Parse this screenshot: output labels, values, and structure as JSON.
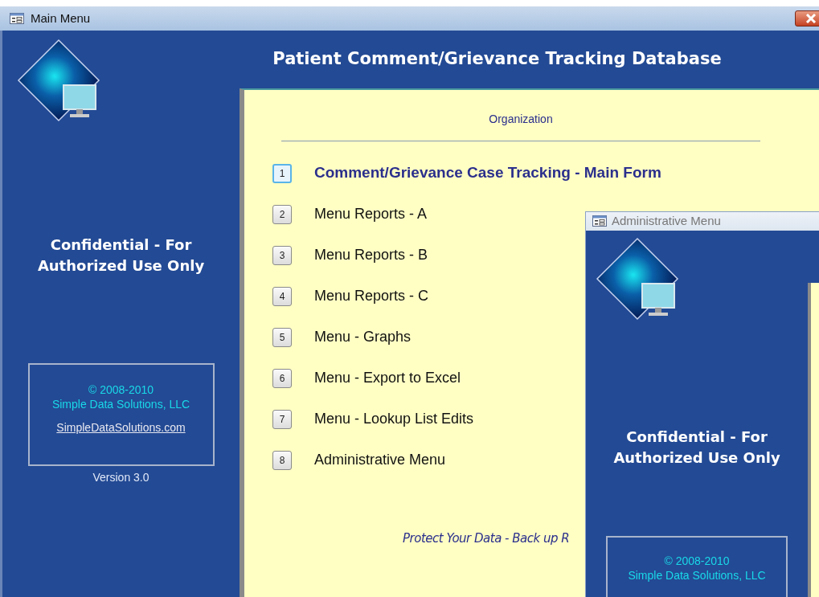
{
  "window": {
    "title": "Main Menu",
    "header": "Patient Comment/Grievance Tracking Database"
  },
  "sidebar": {
    "notice": "Confidential - For Authorized Use Only",
    "copyright": "© 2008-2010",
    "company": "Simple Data Solutions, LLC",
    "link": "SimpleDataSolutions.com",
    "version": "Version 3.0"
  },
  "panel": {
    "organization": "Organization",
    "menu": [
      {
        "key": "1",
        "label": "Comment/Grievance Case Tracking - Main Form",
        "selected": true
      },
      {
        "key": "2",
        "label": "Menu Reports - A",
        "selected": false
      },
      {
        "key": "3",
        "label": "Menu Reports - B",
        "selected": false
      },
      {
        "key": "4",
        "label": "Menu Reports - C",
        "selected": false
      },
      {
        "key": "5",
        "label": "Menu - Graphs",
        "selected": false
      },
      {
        "key": "6",
        "label": "Menu - Export to Excel",
        "selected": false
      },
      {
        "key": "7",
        "label": "Menu - Lookup List Edits",
        "selected": false
      },
      {
        "key": "8",
        "label": "Administrative Menu",
        "selected": false
      }
    ],
    "footer": "Protect Your Data - Back up R"
  },
  "admin_window": {
    "title": "Administrative Menu",
    "notice": "Confidential - For Authorized Use Only",
    "copyright": "© 2008-2010",
    "company": "Simple Data Solutions, LLC"
  }
}
